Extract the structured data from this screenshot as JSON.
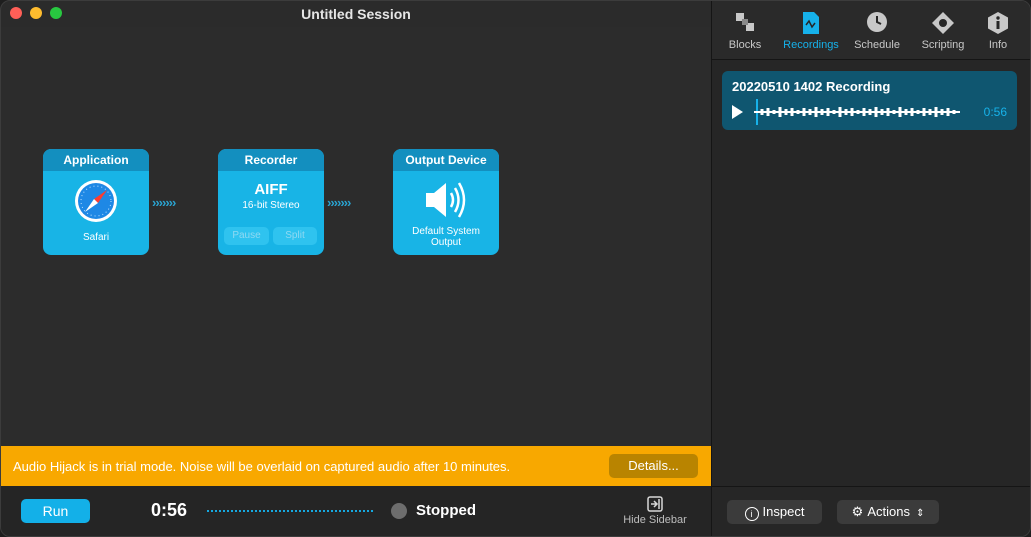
{
  "window": {
    "title": "Untitled Session"
  },
  "blocks": {
    "application": {
      "header": "Application",
      "label": "Safari"
    },
    "recorder": {
      "header": "Recorder",
      "format": "AIFF",
      "detail": "16-bit Stereo",
      "pause_label": "Pause",
      "split_label": "Split"
    },
    "output": {
      "header": "Output Device",
      "label": "Default System Output"
    }
  },
  "chevrons": "›››››››",
  "trial": {
    "message": "Audio Hijack is in trial mode. Noise will be overlaid on captured audio after 10 minutes.",
    "details_label": "Details..."
  },
  "bottom": {
    "run_label": "Run",
    "timer": "0:56",
    "status": "Stopped",
    "hide_sidebar_label": "Hide Sidebar"
  },
  "sidebar": {
    "tabs": [
      {
        "label": "Blocks",
        "icon": "blocks-icon"
      },
      {
        "label": "Recordings",
        "icon": "recordings-icon"
      },
      {
        "label": "Schedule",
        "icon": "clock-icon"
      },
      {
        "label": "Scripting",
        "icon": "scripting-icon"
      },
      {
        "label": "Info",
        "icon": "info-icon"
      }
    ],
    "active_tab": "Recordings",
    "recording": {
      "title": "20220510 1402 Recording",
      "duration": "0:56"
    },
    "inspect_label": "Inspect",
    "actions_label": "Actions"
  },
  "colors": {
    "accent": "#13b0e8",
    "trial_banner": "#f8a800",
    "block": "#18b4e6",
    "block_header": "#138fbf",
    "recording_card": "#0f5670"
  }
}
